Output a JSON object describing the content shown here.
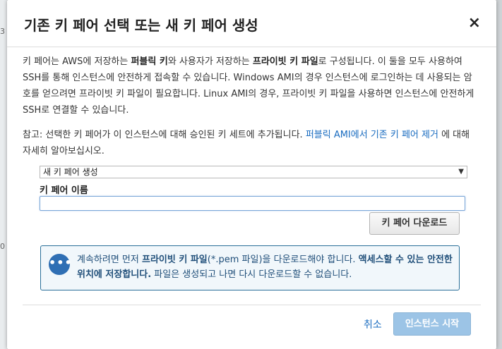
{
  "dialog": {
    "title": "기존 키 페어 선택 또는 새 키 페어 생성",
    "close_label": "×"
  },
  "description": {
    "part1": "키 페어는 AWS에 저장하는 ",
    "bold1": "퍼블릭 키",
    "part2": "와 사용자가 저장하는 ",
    "bold2": "프라이빗 키 파일",
    "part3": "로 구성됩니다. 이 둘을 모두 사용하여 SSH를 통해 인스턴스에 안전하게 접속할 수 있습니다. Windows AMI의 경우 인스턴스에 로그인하는 데 사용되는 암호를 얻으려면 프라이빗 키 파일이 필요합니다. Linux AMI의 경우, 프라이빗 키 파일을 사용하면 인스턴스에 안전하게 SSH로 연결할 수 있습니다."
  },
  "note": {
    "prefix": "참고: 선택한 키 페어가 이 인스턴스에 대해 승인된 키 세트에 추가됩니다. ",
    "link": "퍼블릭 AMI에서 기존 키 페어 제거",
    "suffix": " 에 대해 자세히 알아보십시오."
  },
  "key_pair_select": {
    "selected": "새 키 페어 생성"
  },
  "key_pair_name": {
    "label": "키 페어 이름",
    "value": ""
  },
  "download_button": "키 페어 다운로드",
  "info": {
    "icon": "speech-bubble-icon",
    "part1": "계속하려면 먼저 ",
    "bold1": "프라이빗 키 파일",
    "part2": "(*.pem 파일)을 다운로드해야 합니다. ",
    "bold2": "액세스할 수 있는 안전한 위치에 저장합니다.",
    "part3": " 파일은 생성되고 나면 다시 다운로드할 수 없습니다."
  },
  "footer": {
    "cancel": "취소",
    "launch": "인스턴스 시작"
  },
  "background": {
    "marks": [
      "3",
      "0"
    ]
  },
  "colors": {
    "link": "#1a6cc0",
    "info_border": "#2a6f99",
    "info_bg": "#f1f7fb",
    "launch_button": "#9cc4e6"
  }
}
